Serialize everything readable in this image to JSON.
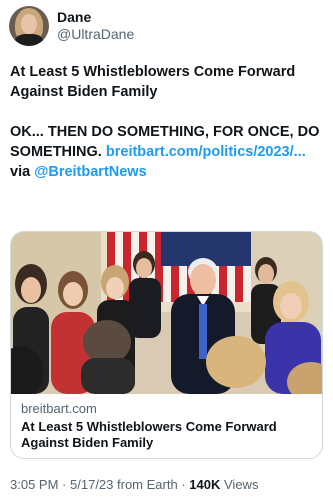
{
  "author": {
    "display_name": "Dane",
    "handle": "@UltraDane"
  },
  "tweet": {
    "headline": "At Least 5 Whistleblowers Come Forward Against Biden Family",
    "comment": "OK... THEN DO SOMETHING, FOR ONCE, DO SOMETHING.",
    "link_text": "breitbart.com/politics/2023/...",
    "via_text": "via",
    "via_account": "@BreitbartNews"
  },
  "card": {
    "domain": "breitbart.com",
    "title": "At Least 5 Whistleblowers Come Forward Against Biden Family"
  },
  "meta": {
    "time": "3:05 PM",
    "date": "5/17/23",
    "source": "from Earth",
    "views_count": "140K",
    "views_label": "Views",
    "separator": "·"
  },
  "colors": {
    "link": "#1d9bf0",
    "secondary_text": "#536471",
    "primary_text": "#0f1419",
    "border": "#cfd9de"
  }
}
